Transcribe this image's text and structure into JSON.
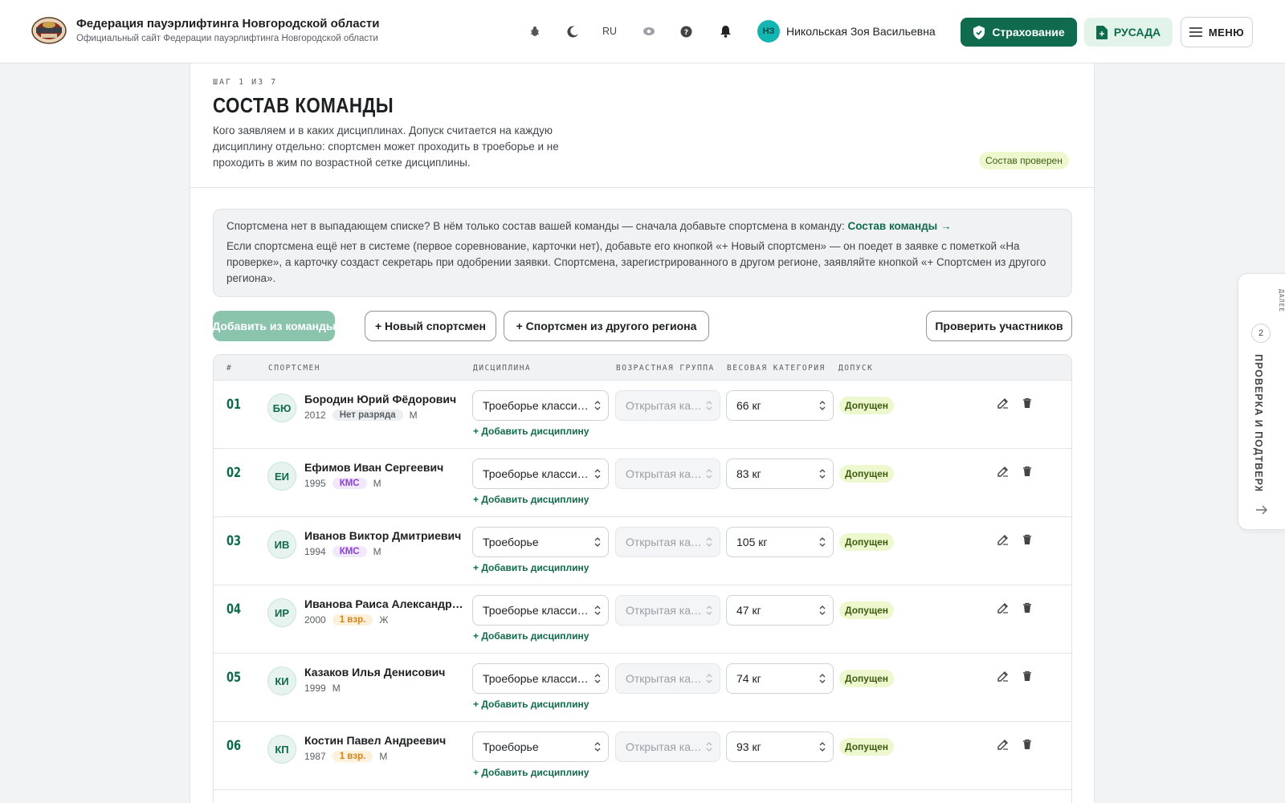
{
  "header": {
    "title": "Федерация пауэрлифтинга Новгородской области",
    "subtitle": "Официальный сайт Федерации пауэрлифтинга Новгородской области",
    "lang": "RU",
    "user_initials": "НЗ",
    "user_name": "Никольская Зоя Васильевна",
    "insurance_label": "Страхование",
    "rusada_label": "РУСАДА",
    "menu_label": "МЕНЮ",
    "icons": [
      "bug-icon",
      "moon-icon",
      "eye-icon",
      "help-icon",
      "bell-icon"
    ]
  },
  "page": {
    "step": "ШАГ 1 ИЗ 7",
    "title": "СОСТАВ КОМАНДЫ",
    "description": "Кого заявляем и в каких дисциплинах. Допуск считается на каждую дисциплину отдельно: спортсмен может проходить в троеборье и не проходить в жим по возрастной сетке дисциплины.",
    "status_badge": "Состав проверен"
  },
  "info": {
    "line1": "Спортсмена нет в выпадающем списке? В нём только состав вашей команды — сначала добавьте спортсмена в команду: ",
    "link": "Состав команды →",
    "line2": "Если спортсмена ещё нет в системе (первое соревнование, карточки нет), добавьте его кнопкой «+ Новый спортсмен» — он поедет в заявке с пометкой «На проверке», а карточку создаст секретарь при одобрении заявки. Спортсмена, зарегистрированного в другом регионе, заявляйте кнопкой «+ Спортсмен из другого региона»."
  },
  "actions": {
    "add_from_team": "Добавить из команды",
    "new_athlete": "+ Новый спортсмен",
    "other_region": "+ Спортсмен из другого региона",
    "check": "Проверить участников"
  },
  "table": {
    "headers": {
      "num": "#",
      "athlete": "СПОРТСМЕН",
      "discipline": "ДИСЦИПЛИНА",
      "age_group": "ВОЗРАСТНАЯ ГРУППА",
      "weight": "ВЕСОВАЯ КАТЕГОРИЯ",
      "admission": "ДОПУСК"
    },
    "add_discipline_label": "+ Добавить дисциплину",
    "rows": [
      {
        "num": "01",
        "initials": "БЮ",
        "name": "Бородин Юрий Фёдорович",
        "year": "2012",
        "rank": "Нет разряда",
        "rank_type": "none",
        "sex": "М",
        "discipline": "Троеборье классическое",
        "age": "Открытая категория",
        "weight": "66 кг",
        "status": "Допущен"
      },
      {
        "num": "02",
        "initials": "ЕИ",
        "name": "Ефимов Иван Сергеевич",
        "year": "1995",
        "rank": "КМС",
        "rank_type": "kms",
        "sex": "М",
        "discipline": "Троеборье классическое",
        "age": "Открытая категория",
        "weight": "83 кг",
        "status": "Допущен"
      },
      {
        "num": "03",
        "initials": "ИВ",
        "name": "Иванов Виктор Дмитриевич",
        "year": "1994",
        "rank": "КМС",
        "rank_type": "kms",
        "sex": "М",
        "discipline": "Троеборье",
        "age": "Открытая категория",
        "weight": "105 кг",
        "status": "Допущен"
      },
      {
        "num": "04",
        "initials": "ИР",
        "name": "Иванова Раиса Александровна",
        "year": "2000",
        "rank": "1 взр.",
        "rank_type": "v1",
        "sex": "Ж",
        "discipline": "Троеборье классическое",
        "age": "Открытая категория",
        "weight": "47 кг",
        "status": "Допущен"
      },
      {
        "num": "05",
        "initials": "КИ",
        "name": "Казаков Илья Денисович",
        "year": "1999",
        "rank": "",
        "rank_type": "",
        "sex": "М",
        "discipline": "Троеборье классическое",
        "age": "Открытая категория",
        "weight": "74 кг",
        "status": "Допущен"
      },
      {
        "num": "06",
        "initials": "КП",
        "name": "Костин Павел Андреевич",
        "year": "1987",
        "rank": "1 взр.",
        "rank_type": "v1",
        "sex": "М",
        "discipline": "Троеборье",
        "age": "Открытая категория",
        "weight": "93 кг",
        "status": "Допущен"
      }
    ]
  },
  "side_panel": {
    "next_label": "ДАЛЕЕ",
    "step_num": "2",
    "label": "ПРОВЕРКА И ПОДТВЕРЖДЕНИЕ"
  }
}
